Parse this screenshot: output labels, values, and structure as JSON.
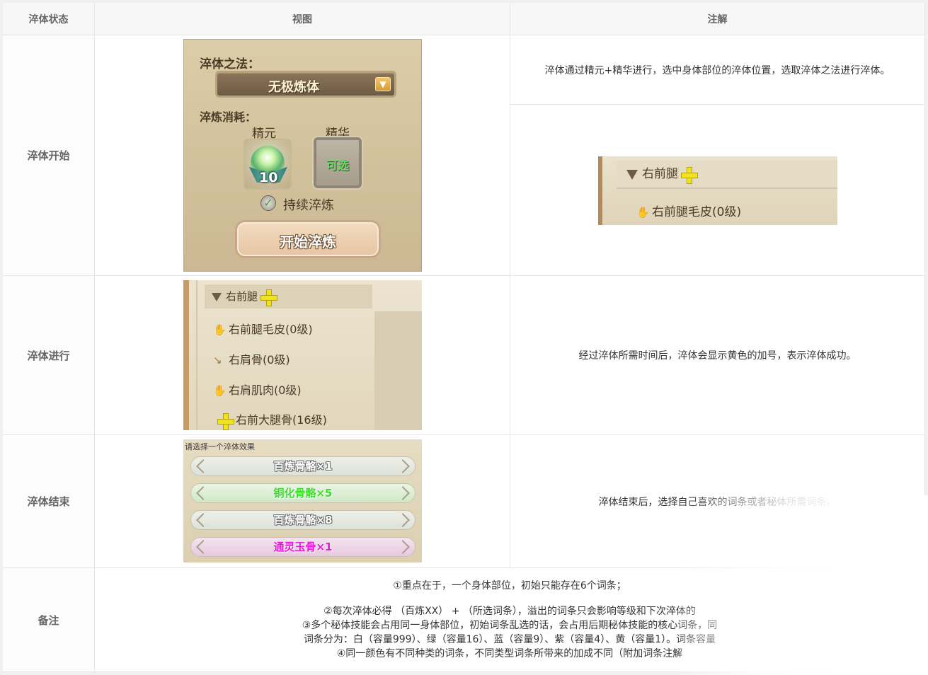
{
  "header": {
    "col_state": "淬体状态",
    "col_view": "视图",
    "col_note": "注解"
  },
  "rows": {
    "start": {
      "label": "淬体开始",
      "note": "淬体通过精元+精华进行，选中身体部位的淬体位置，选取淬体之法进行淬体。",
      "panel": {
        "method_title": "淬体之法：",
        "method_value": "无极炼体",
        "cost_title": "淬炼消耗：",
        "slot1_label": "精元",
        "slot1_count": "10",
        "slot2_label": "精华",
        "slot2_value": "可选",
        "continuous_label": "持续淬炼",
        "start_button": "开始淬炼"
      },
      "tree": {
        "head": "右前腿",
        "item": "右前腿毛皮(0级)"
      }
    },
    "progress": {
      "label": "淬体进行",
      "note": "经过淬体所需时间后，淬体会显示黄色的加号，表示淬体成功。",
      "tree": {
        "head": "右前腿",
        "items": [
          "右前腿毛皮(0级)",
          "右肩骨(0级)",
          "右肩肌肉(0级)",
          "右前大腿骨(16级)"
        ]
      }
    },
    "end": {
      "label": "淬体结束",
      "note": "淬体结束后，选择自己喜欢的词条或者秘体所需词条。",
      "panel": {
        "caption": "请选择一个淬体效果",
        "options": [
          {
            "text": "百炼骨骼×1",
            "color": "#ffffff"
          },
          {
            "text": "铜化骨骼×5",
            "color": "#3ddc2e"
          },
          {
            "text": "百炼骨骼×8",
            "color": "#ffffff"
          },
          {
            "text": "通灵玉骨×1",
            "color": "#e21ad8"
          }
        ]
      }
    },
    "remarks": {
      "label": "备注",
      "lines": [
        "①重点在于，一个身体部位，初始只能存在6个词条；",
        "②每次淬体必得 （百炼XX） + （所选词条），溢出的词条只会影响等级和下次淬体的",
        "③多个秘体技能会占用同一身体部位，初始词条乱选的话，会占用后期秘体技能的核心词条，同",
        "词条分为：白（容量999）、绿（容量16）、蓝（容量9）、紫（容量4）、黄（容量1）。词条容量",
        "④同一颜色有不同种类的词条，不同类型词条所带来的加成不同（附加词条注解"
      ]
    }
  }
}
